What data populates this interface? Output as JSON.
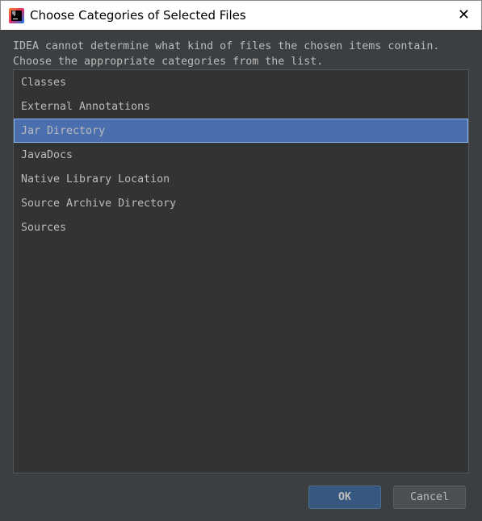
{
  "window": {
    "title": "Choose Categories of Selected Files"
  },
  "message": {
    "line1": "IDEA cannot determine what kind of files the chosen items contain.",
    "line2": "Choose the appropriate categories from the list."
  },
  "categories": [
    {
      "label": "Classes",
      "selected": false
    },
    {
      "label": "External Annotations",
      "selected": false
    },
    {
      "label": "Jar Directory",
      "selected": true
    },
    {
      "label": "JavaDocs",
      "selected": false
    },
    {
      "label": "Native Library Location",
      "selected": false
    },
    {
      "label": "Source Archive Directory",
      "selected": false
    },
    {
      "label": "Sources",
      "selected": false
    }
  ],
  "buttons": {
    "ok": "OK",
    "cancel": "Cancel"
  },
  "colors": {
    "selection": "#4b6eaf",
    "background": "#3c3f41",
    "ok_button": "#365880"
  }
}
